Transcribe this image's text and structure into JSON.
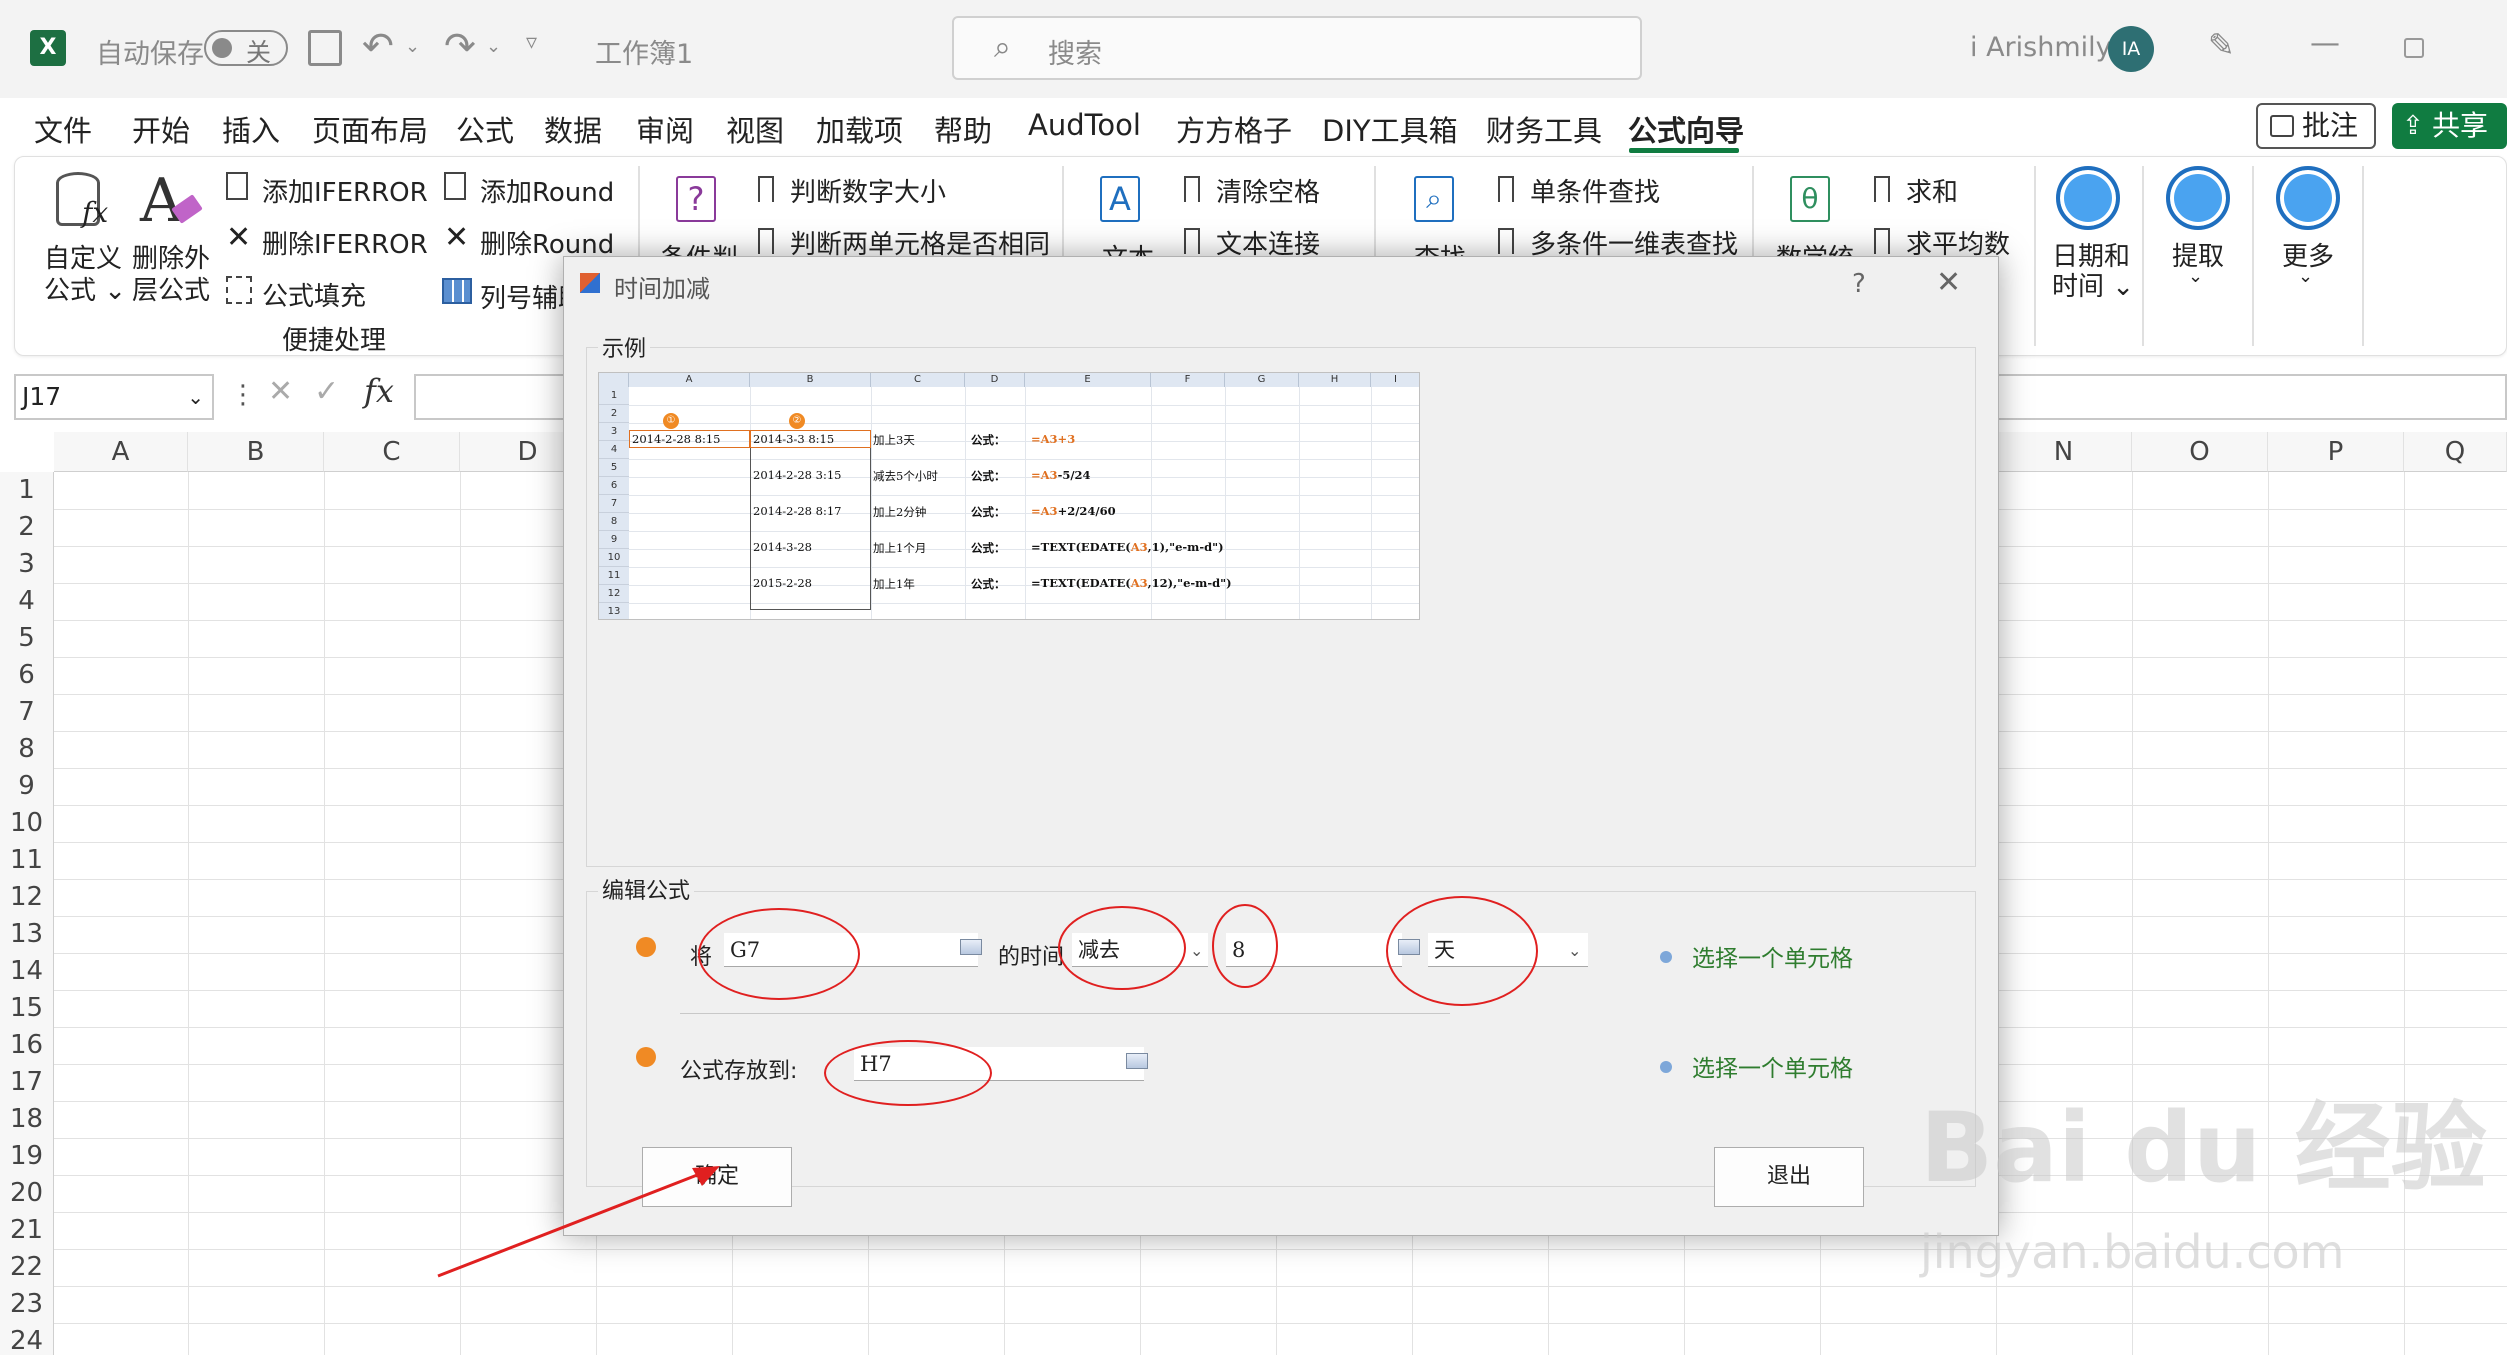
{
  "titlebar": {
    "autosave_label": "自动保存",
    "autosave_state": "关",
    "doc_title": "工作簿1",
    "search_placeholder": "搜索",
    "user_name": "i Arishmily",
    "user_initials": "IA"
  },
  "menu": {
    "tabs": [
      "文件",
      "开始",
      "插入",
      "页面布局",
      "公式",
      "数据",
      "审阅",
      "视图",
      "加载项",
      "帮助",
      "AudTool",
      "方方格子",
      "DIY工具箱",
      "财务工具",
      "公式向导"
    ],
    "active": "公式向导",
    "comment_label": "批注",
    "share_label": "共享"
  },
  "ribbon": {
    "custom_formula": [
      "自定义",
      "公式"
    ],
    "remove_external": [
      "删除外",
      "层公式"
    ],
    "add_iferror": "添加IFERROR",
    "remove_iferror": "删除IFERROR",
    "formula_fill": "公式填充",
    "add_round": "添加Round",
    "remove_round": "删除Round",
    "col_helper": "列号辅助",
    "group_convenience": "便捷处理",
    "condition_judge": "条件判",
    "is_number": "判断数字大小",
    "same_cells": "判断两单元格是否相同",
    "text": "文本",
    "clear_spaces": "清除空格",
    "text_concat": "文本连接",
    "lookup": "查找",
    "single_lookup": "单条件查找",
    "multi_lookup": "多条件一维表查找",
    "math": "数学统",
    "sum": "求和",
    "average": "求平均数",
    "datetime": [
      "日期和",
      "时间"
    ],
    "extract": "提取",
    "more": "更多"
  },
  "formula_bar": {
    "name_box": "J17",
    "fx": "fx"
  },
  "sheet": {
    "columns": [
      "A",
      "B",
      "C",
      "D",
      "N",
      "O",
      "P",
      "Q"
    ],
    "rows": [
      "1",
      "2",
      "3",
      "4",
      "5",
      "6",
      "7",
      "8",
      "9",
      "10",
      "11",
      "12",
      "13",
      "14",
      "15",
      "16",
      "17",
      "18",
      "19",
      "20",
      "21",
      "22",
      "23",
      "24"
    ]
  },
  "dialog": {
    "title": "时间加减",
    "help": "?",
    "example_label": "示例",
    "edit_label": "编辑公式",
    "row1_prefix": "将",
    "cell_ref": "G7",
    "middle_text": "的时间",
    "operation": "减去",
    "amount": "8",
    "unit": "天",
    "store_label": "公式存放到:",
    "store_cell": "H7",
    "hint1": "选择一个单元格",
    "hint2": "选择一个单元格",
    "ok_label": "确定",
    "exit_label": "退出",
    "sample": {
      "col_headers": [
        "A",
        "B",
        "C",
        "D",
        "E",
        "F",
        "G",
        "H",
        "I"
      ],
      "row_headers": [
        "1",
        "2",
        "3",
        "4",
        "5",
        "6",
        "7",
        "8",
        "9",
        "10",
        "11",
        "12",
        "13"
      ],
      "badge_a": "①",
      "badge_b": "②",
      "a3": "2014-2-28 8:15",
      "b3": "2014-3-3 8:15",
      "c3": "加上3天",
      "d3": "公式：",
      "e3": "=A3+3",
      "b5": "2014-2-28 3:15",
      "c5": "减去5个小时",
      "d5": "公式：",
      "e5_ref": "=A3",
      "e5_rest": "-5/24",
      "b7": "2014-2-28 8:17",
      "c7": "加上2分钟",
      "d7": "公式：",
      "e7_ref": "=A3",
      "e7_rest": "+2/24/60",
      "b9": "2014-3-28",
      "c9": "加上1个月",
      "d9": "公式：",
      "e9_a": "=TEXT(EDATE(",
      "e9_ref": "A3",
      "e9_b": ",1),\"e-m-d\")",
      "b11": "2015-2-28",
      "c11": "加上1年",
      "d11": "公式：",
      "e11_a": "=TEXT(EDATE(",
      "e11_ref": "A3",
      "e11_b": ",12),\"e-m-d\")"
    }
  },
  "watermark": {
    "main": "Bai du 经验",
    "sub": "jingyan.baidu.com"
  },
  "colors": {
    "excel_green": "#107c41",
    "annotation_red": "#e02020",
    "hint_green": "#2f7d2f",
    "sample_orange": "#e07020"
  }
}
